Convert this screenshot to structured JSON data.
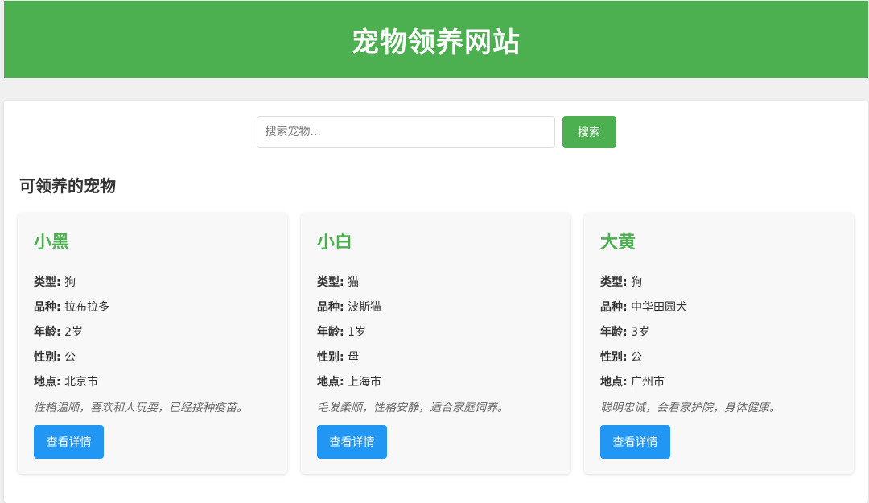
{
  "header": {
    "title": "宠物领养网站"
  },
  "search": {
    "placeholder": "搜索宠物...",
    "value": "",
    "button_label": "搜索"
  },
  "section": {
    "title": "可领养的宠物"
  },
  "labels": {
    "type": "类型:",
    "breed": "品种:",
    "age": "年龄:",
    "gender": "性别:",
    "location": "地点:"
  },
  "pets": [
    {
      "name": "小黑",
      "type": "狗",
      "breed": "拉布拉多",
      "age": "2岁",
      "gender": "公",
      "location": "北京市",
      "description": "性格温顺，喜欢和人玩耍，已经接种疫苗。",
      "button_label": "查看详情"
    },
    {
      "name": "小白",
      "type": "猫",
      "breed": "波斯猫",
      "age": "1岁",
      "gender": "母",
      "location": "上海市",
      "description": "毛发柔顺，性格安静，适合家庭饲养。",
      "button_label": "查看详情"
    },
    {
      "name": "大黄",
      "type": "狗",
      "breed": "中华田园犬",
      "age": "3岁",
      "gender": "公",
      "location": "广州市",
      "description": "聪明忠诚，会看家护院，身体健康。",
      "button_label": "查看详情"
    }
  ],
  "colors": {
    "header_bg": "#4caf50",
    "accent_green": "#4caf50",
    "detail_button": "#2196f3",
    "page_bg": "#f0f0f0"
  }
}
